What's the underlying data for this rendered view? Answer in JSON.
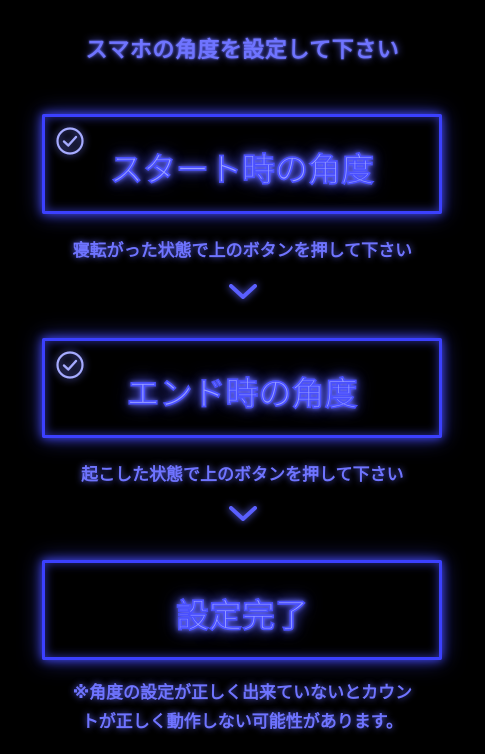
{
  "header": {
    "title": "スマホの角度を設定して下さい"
  },
  "steps": [
    {
      "label": "スタート時の角度",
      "checked": true,
      "hint": "寝転がった状態で上のボタンを押して下さい"
    },
    {
      "label": "エンド時の角度",
      "checked": true,
      "hint": "起こした状態で上のボタンを押して下さい"
    }
  ],
  "complete_button": {
    "label": "設定完了"
  },
  "footer": {
    "note_line1": "※角度の設定が正しく出来ていないとカウン",
    "note_line2": "トが正しく動作しない可能性があります。"
  },
  "icons": {
    "check": "check-circle-icon",
    "chevron": "chevron-down-icon"
  },
  "colors": {
    "background": "#000000",
    "neon_border": "#3b40ff",
    "text": "#6f74ff",
    "button_text": "#9aa0ff"
  }
}
